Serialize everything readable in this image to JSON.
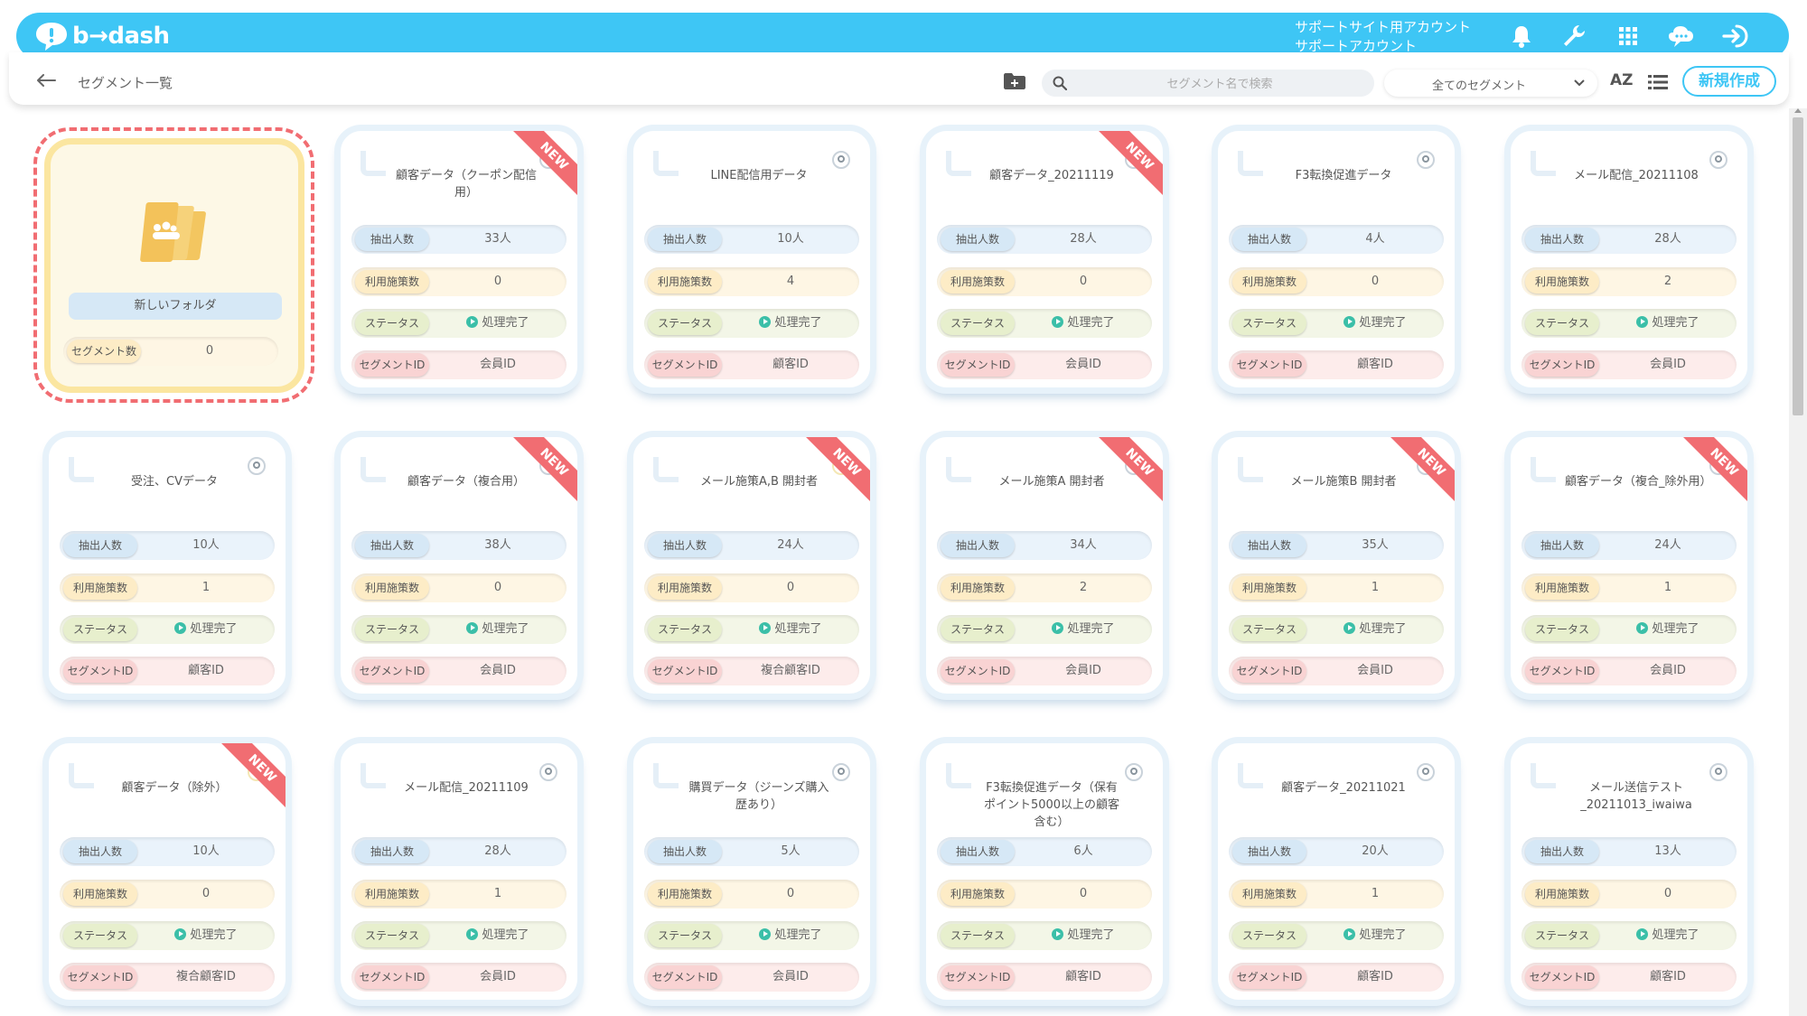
{
  "header": {
    "logo_text": "b→dash",
    "account_line1": "サポートサイト用アカウント",
    "account_line2": "サポートアカウント",
    "icons": [
      "bell-icon",
      "wrench-icon",
      "apps-grid-icon",
      "chat-cloud-icon",
      "logout-icon"
    ]
  },
  "subheader": {
    "page_title": "セグメント一覧",
    "search_placeholder": "セグメント名で検索",
    "filter_selected": "全てのセグメント",
    "sort_label": "AZ",
    "new_button": "新規作成"
  },
  "labels": {
    "extracted": "抽出人数",
    "used": "利用施策数",
    "status": "ステータス",
    "segment_id": "セグメントID",
    "new_badge": "NEW",
    "folder_count": "セグメント数"
  },
  "folder": {
    "name": "新しいフォルダ",
    "count": "0"
  },
  "segments": [
    {
      "title": "顧客データ（クーポン配信用）",
      "extracted": "33人",
      "used": "0",
      "status": "処理完了",
      "id_type": "会員ID",
      "is_new": true
    },
    {
      "title": "LINE配信用データ",
      "extracted": "10人",
      "used": "4",
      "status": "処理完了",
      "id_type": "顧客ID",
      "is_new": false
    },
    {
      "title": "顧客データ_20211119",
      "extracted": "28人",
      "used": "0",
      "status": "処理完了",
      "id_type": "会員ID",
      "is_new": true
    },
    {
      "title": "F3転換促進データ",
      "extracted": "4人",
      "used": "0",
      "status": "処理完了",
      "id_type": "顧客ID",
      "is_new": false
    },
    {
      "title": "メール配信_20211108",
      "extracted": "28人",
      "used": "2",
      "status": "処理完了",
      "id_type": "会員ID",
      "is_new": false
    },
    {
      "title": "受注、CVデータ",
      "extracted": "10人",
      "used": "1",
      "status": "処理完了",
      "id_type": "顧客ID",
      "is_new": false
    },
    {
      "title": "顧客データ（複合用）",
      "extracted": "38人",
      "used": "0",
      "status": "処理完了",
      "id_type": "会員ID",
      "is_new": true
    },
    {
      "title": "メール施策A,B 開封者",
      "extracted": "24人",
      "used": "0",
      "status": "処理完了",
      "id_type": "複合顧客ID",
      "is_new": true,
      "pin_gold": true
    },
    {
      "title": "メール施策A 開封者",
      "extracted": "34人",
      "used": "2",
      "status": "処理完了",
      "id_type": "会員ID",
      "is_new": true
    },
    {
      "title": "メール施策B 開封者",
      "extracted": "35人",
      "used": "1",
      "status": "処理完了",
      "id_type": "会員ID",
      "is_new": true
    },
    {
      "title": "顧客データ（複合_除外用）",
      "extracted": "24人",
      "used": "1",
      "status": "処理完了",
      "id_type": "会員ID",
      "is_new": true
    },
    {
      "title": "顧客データ（除外）",
      "extracted": "10人",
      "used": "0",
      "status": "処理完了",
      "id_type": "複合顧客ID",
      "is_new": true,
      "pin_gold": true
    },
    {
      "title": "メール配信_20211109",
      "extracted": "28人",
      "used": "1",
      "status": "処理完了",
      "id_type": "会員ID",
      "is_new": false
    },
    {
      "title": "購買データ（ジーンズ購入歴あり）",
      "extracted": "5人",
      "used": "0",
      "status": "処理完了",
      "id_type": "会員ID",
      "is_new": false
    },
    {
      "title": "F3転換促進データ（保有ポイント5000以上の顧客含む）",
      "extracted": "6人",
      "used": "0",
      "status": "処理完了",
      "id_type": "顧客ID",
      "is_new": false
    },
    {
      "title": "顧客データ_20211021",
      "extracted": "20人",
      "used": "1",
      "status": "処理完了",
      "id_type": "顧客ID",
      "is_new": false
    },
    {
      "title": "メール送信テスト_20211013_iwaiwa",
      "extracted": "13人",
      "used": "0",
      "status": "処理完了",
      "id_type": "顧客ID",
      "is_new": false
    }
  ],
  "colors": {
    "brand": "#3ec6f5",
    "new_ribbon": "#f16d72",
    "folder_border": "#fbe6a0",
    "status_icon": "#3bbfa8"
  }
}
